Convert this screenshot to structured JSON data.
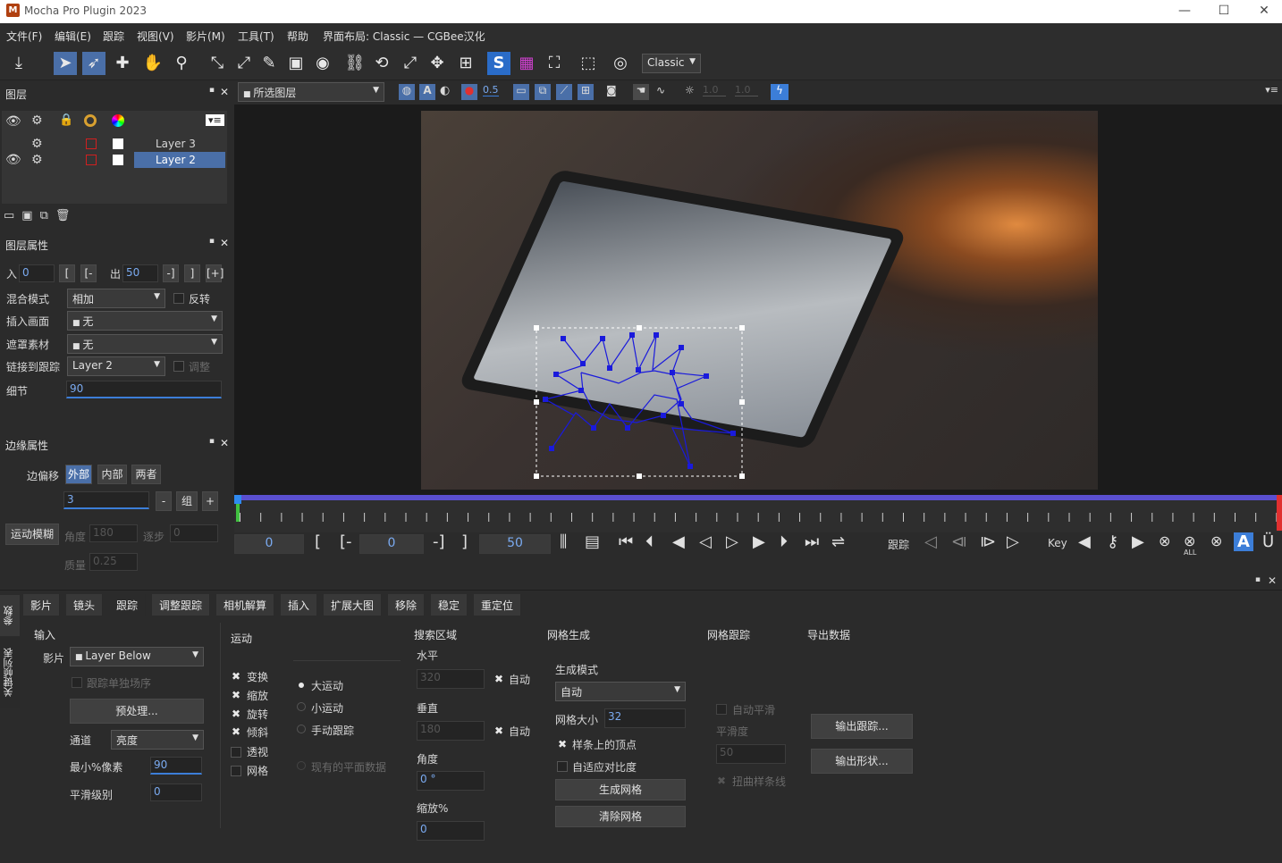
{
  "window": {
    "title": "Mocha Pro Plugin 2023",
    "minimize": "—",
    "maximize": "☐",
    "close": "✕"
  },
  "menu": [
    "文件(F)",
    "编辑(E)",
    "跟踪",
    "视图(V)",
    "影片(M)",
    "工具(T)",
    "帮助",
    "界面布局: Classic — CGBee汉化"
  ],
  "toolbar": {
    "layout_select": "Classic",
    "opacity_value": "0.5",
    "val_a": "1.0",
    "val_b": "1.0",
    "layer_filter": "所选图层"
  },
  "layers_panel": {
    "title": "图层",
    "layers": [
      {
        "name": "Layer 3",
        "selected": false
      },
      {
        "name": "Layer 2",
        "selected": true
      }
    ]
  },
  "layer_props": {
    "title": "图层属性",
    "in_label": "入",
    "in_value": "0",
    "out_label": "出",
    "out_value": "50",
    "blend_label": "混合模式",
    "blend_value": "相加",
    "invert_label": "反转",
    "insert_label": "插入画面",
    "insert_value": "无",
    "matte_label": "遮罩素材",
    "matte_value": "无",
    "link_label": "链接到跟踪",
    "link_value": "Layer 2",
    "adjust_label": "调整",
    "detail_label": "细节",
    "detail_value": "90"
  },
  "edge_props": {
    "title": "边缘属性",
    "offset_label": "边偏移",
    "btn_outer": "外部",
    "btn_inner": "内部",
    "btn_both": "两者",
    "offset_value": "3",
    "minus": "-",
    "group": "组",
    "plus": "+",
    "motion_blur": "运动模糊",
    "angle_label": "角度",
    "angle_value": "180",
    "step_label": "逐步",
    "step_value": "0",
    "quality_label": "质量",
    "quality_value": "0.25"
  },
  "transport": {
    "frame_start": "0",
    "frame_current": "0",
    "frame_end": "50",
    "track_label": "跟踪",
    "key_label": "Key",
    "all_label": "ALL"
  },
  "bottom_tabs": [
    "影片",
    "镜头",
    "跟踪",
    "调整跟踪",
    "相机解算",
    "插入",
    "扩展大图",
    "移除",
    "稳定",
    "重定位"
  ],
  "side_tabs": [
    "参数",
    "关键帧列表"
  ],
  "params": {
    "input": {
      "title": "输入",
      "clip_label": "影片",
      "clip_value": "Layer Below",
      "track_individual": "跟踪单独场序",
      "preprocess_btn": "预处理...",
      "channel_label": "通道",
      "channel_value": "亮度",
      "min_pixels_label": "最小%像素",
      "min_pixels_value": "90",
      "smooth_label": "平滑级别",
      "smooth_value": "0"
    },
    "motion": {
      "title": "运动",
      "checks": [
        {
          "label": "变换",
          "on": true
        },
        {
          "label": "缩放",
          "on": true
        },
        {
          "label": "旋转",
          "on": true
        },
        {
          "label": "倾斜",
          "on": true
        },
        {
          "label": "透视",
          "on": false
        },
        {
          "label": "网格",
          "on": false
        }
      ],
      "radios": [
        {
          "label": "大运动",
          "on": true
        },
        {
          "label": "小运动",
          "on": false
        },
        {
          "label": "手动跟踪",
          "on": false
        }
      ],
      "existing_planar": "现有的平面数据"
    },
    "search": {
      "title": "搜索区域",
      "h_label": "水平",
      "h_value": "320",
      "h_auto": "自动",
      "v_label": "垂直",
      "v_value": "180",
      "v_auto": "自动",
      "angle_label": "角度",
      "angle_value": "0 °",
      "zoom_label": "缩放%",
      "zoom_value": "0"
    },
    "mesh_gen": {
      "title": "网格生成",
      "mode_label": "生成模式",
      "mode_value": "自动",
      "size_label": "网格大小",
      "size_value": "32",
      "spline_vertices": "样条上的顶点",
      "adaptive_contrast": "自适应对比度",
      "gen_btn": "生成网格",
      "clear_btn": "清除网格"
    },
    "mesh_track": {
      "title": "网格跟踪",
      "auto_smooth": "自动平滑",
      "smoothness_label": "平滑度",
      "smoothness_value": "50",
      "warp_spline": "扭曲样条线"
    },
    "export": {
      "title": "导出数据",
      "export_track_btn": "输出跟踪...",
      "export_shape_btn": "输出形状..."
    }
  },
  "colors": {
    "accent": "#4a6fa8",
    "spline": "#1a1adc",
    "timeline_bar": "#5a4fd0"
  }
}
